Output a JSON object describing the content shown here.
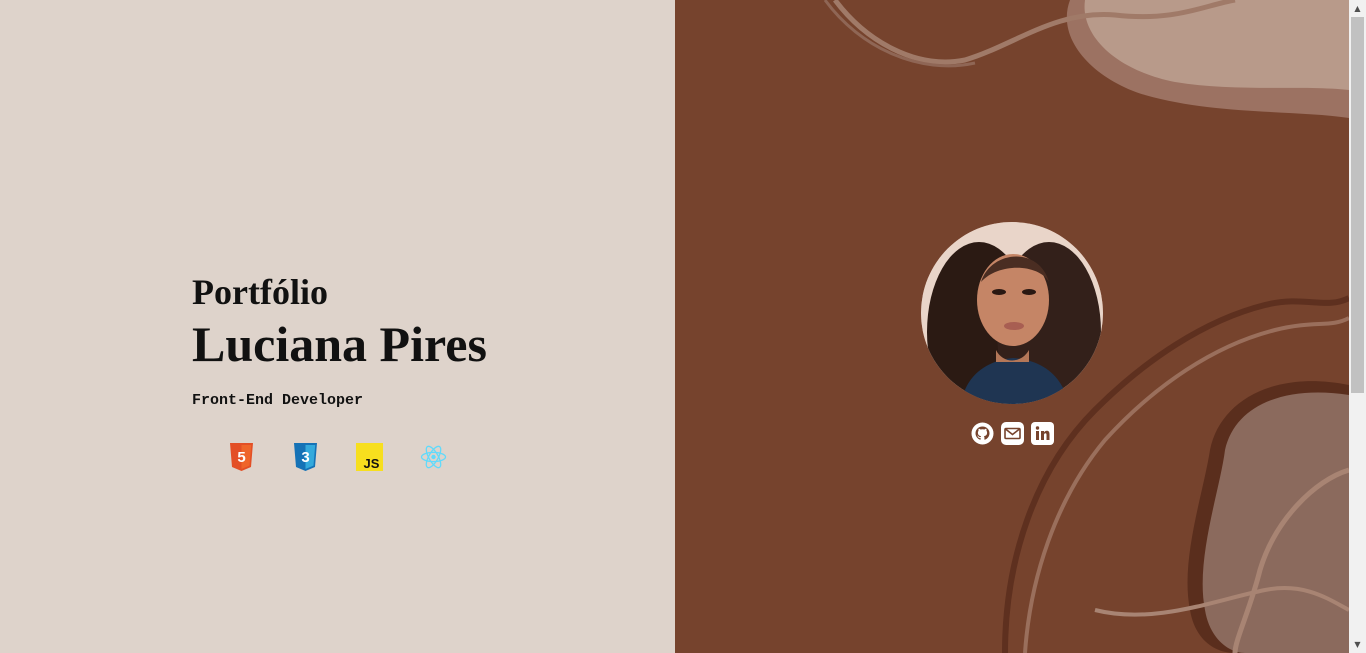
{
  "hero": {
    "subtitle": "Portfólio",
    "name": "Luciana Pires",
    "role": "Front-End Developer"
  },
  "tech_icons": [
    {
      "icon": "html5-icon",
      "label": "5",
      "color": "#e34f26"
    },
    {
      "icon": "css3-icon",
      "label": "3",
      "color": "#1572b6"
    },
    {
      "icon": "javascript-icon",
      "label": "JS",
      "color": "#f7df1e"
    },
    {
      "icon": "react-icon",
      "color": "#61dafb"
    }
  ],
  "socials": [
    {
      "icon": "github-icon"
    },
    {
      "icon": "email-icon"
    },
    {
      "icon": "linkedin-icon"
    }
  ],
  "colors": {
    "left_bg": "#ded3cb",
    "right_bg": "#76432d",
    "blob_light": "#b89a8a",
    "blob_mid": "#9c7262"
  }
}
